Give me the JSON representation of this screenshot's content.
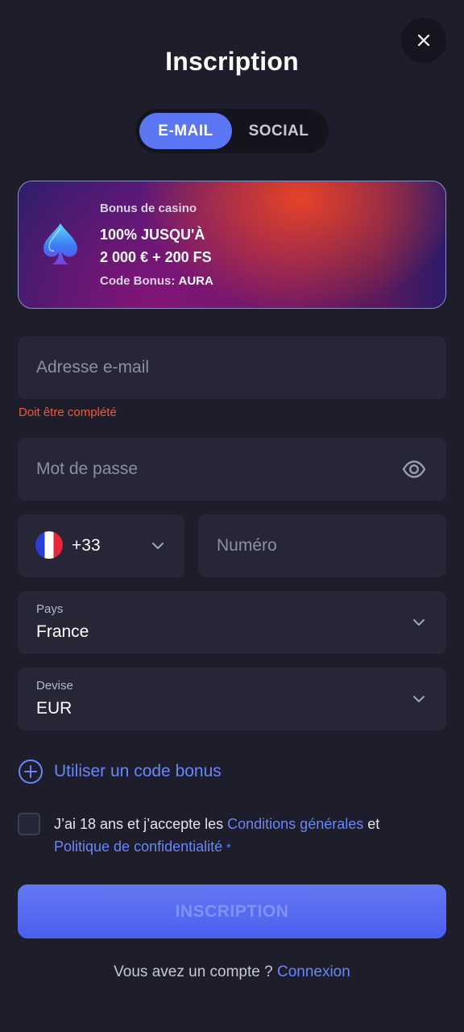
{
  "header": {
    "title": "Inscription"
  },
  "tabs": [
    {
      "label": "E-MAIL",
      "active": true
    },
    {
      "label": "SOCIAL",
      "active": false
    }
  ],
  "bonus": {
    "label": "Bonus de casino",
    "line1": "100% JUSQU'À",
    "line2": "2 000 € + 200 FS",
    "code_prefix": "Code Bonus:",
    "code": "AURA",
    "icon": "spade-icon"
  },
  "form": {
    "email": {
      "placeholder": "Adresse e-mail",
      "error": "Doit être complété"
    },
    "password": {
      "placeholder": "Mot de passe",
      "toggle_icon": "eye-icon"
    },
    "phone": {
      "country_code": "+33",
      "flag": "France",
      "placeholder": "Numéro"
    },
    "country": {
      "label": "Pays",
      "value": "France"
    },
    "currency": {
      "label": "Devise",
      "value": "EUR"
    },
    "bonus_code_link": "Utiliser un code bonus",
    "terms": {
      "text_before": "J’ai 18 ans et j’accepte les ",
      "link1": "Conditions générales",
      "text_middle": " et ",
      "link2": "Politique de confidentialité",
      "required_mark": "*"
    },
    "submit_label": "INSCRIPTION"
  },
  "footer": {
    "prompt": "Vous avez un compte ?",
    "link": "Connexion"
  },
  "colors": {
    "background": "#1d1d2b",
    "field": "#262637",
    "accent": "#5b76f2",
    "link": "#6c86f5",
    "error": "#f05a3a"
  }
}
